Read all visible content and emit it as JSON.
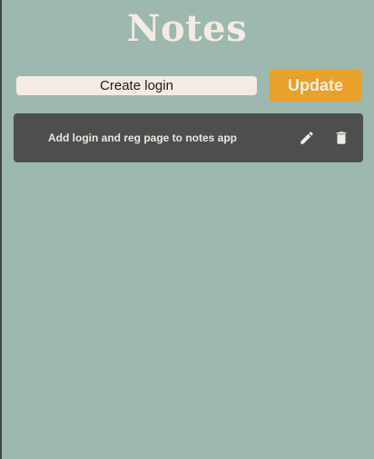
{
  "app": {
    "title": "Notes"
  },
  "form": {
    "input_value": "Create login",
    "update_label": "Update"
  },
  "notes": [
    {
      "text": "Add login and reg page to notes app",
      "edit_icon": "pencil-icon",
      "delete_icon": "trash-icon"
    }
  ],
  "colors": {
    "background": "#9db8ae",
    "title": "#f3ebe4",
    "input_background": "#f3ebe4",
    "button": "#e9a12a",
    "note_card": "#4c4f4d",
    "note_text": "#ece6df"
  }
}
